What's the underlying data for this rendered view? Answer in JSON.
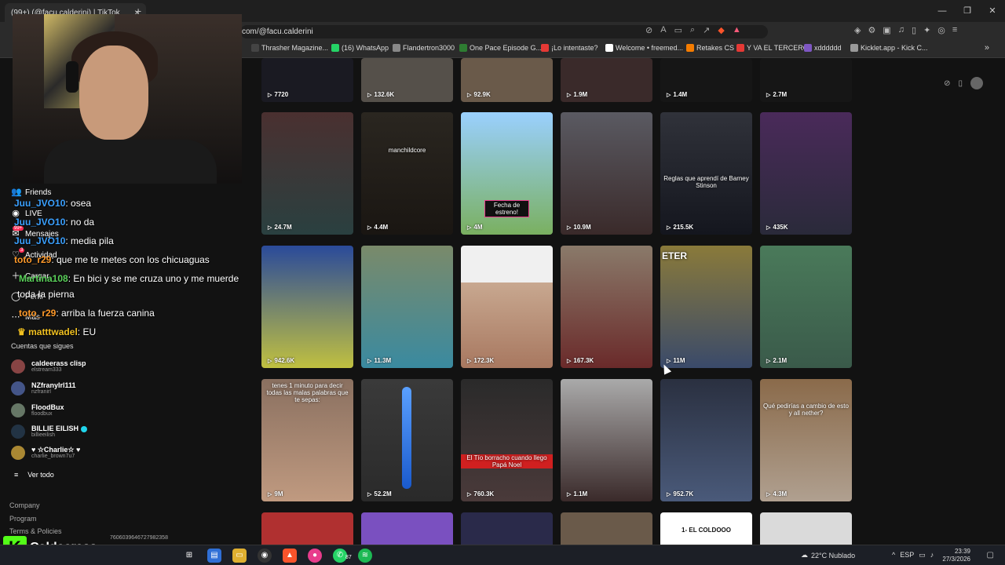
{
  "browser": {
    "tab_title": "(99+) (@facu.calderini) | TikTok",
    "url": "com/@facu.calderini",
    "bookmarks": [
      {
        "label": "Thrasher Magazine...",
        "color": "#444444"
      },
      {
        "label": "(16) WhatsApp",
        "color": "#25d366"
      },
      {
        "label": "Flandertron3000",
        "color": "#888888"
      },
      {
        "label": "One Pace Episode G...",
        "color": "#2e7d32"
      },
      {
        "label": "¡Lo intentaste?",
        "color": "#e53935"
      },
      {
        "label": "Welcome • freemed...",
        "color": "#ffffff"
      },
      {
        "label": "Retakes CS",
        "color": "#f57c00"
      },
      {
        "label": "Y VA EL TERCERO",
        "color": "#e53935"
      },
      {
        "label": "xdddddd",
        "color": "#7e57c2"
      },
      {
        "label": "Kicklet.app - Kick C...",
        "color": "#999999"
      }
    ]
  },
  "sidebar": {
    "nav": [
      {
        "label": "Friends",
        "icon": "friends-icon"
      },
      {
        "label": "LIVE",
        "icon": "live-icon"
      },
      {
        "label": "Mensajes",
        "icon": "messages-icon",
        "badge": "99+"
      },
      {
        "label": "Actividad",
        "icon": "activity-icon",
        "badge": "3"
      },
      {
        "label": "Cargar",
        "icon": "upload-icon"
      },
      {
        "label": "Perfil",
        "icon": "profile-icon"
      },
      {
        "label": "Más",
        "icon": "more-icon"
      }
    ],
    "following_title": "Cuentas que sigues",
    "following": [
      {
        "name": "caldeerass clisp",
        "handle": "elstream333",
        "color": "#884444"
      },
      {
        "name": "NZfranyIrl111",
        "handle": "nzfranirl",
        "color": "#445588"
      },
      {
        "name": "FloodBux",
        "handle": "floodbux",
        "color": "#667766"
      },
      {
        "name": "BILLIE EILISH",
        "handle": "billieeilish",
        "color": "#223344",
        "verified": true
      },
      {
        "name": "♥ ☆Charlie☆ ♥",
        "handle": "charlie_brown7u7",
        "color": "#aa8833"
      }
    ],
    "see_all": "Ver todo",
    "footer": [
      "Company",
      "Program",
      "Terms & Policies"
    ],
    "footer_id": "7606039646727982358"
  },
  "chat": [
    {
      "user": "Juu_JVO10",
      "text": ": osea"
    },
    {
      "user": "Juu_JVO10",
      "text": ": no da"
    },
    {
      "user": "Juu_JVO10",
      "text": ": media pila"
    },
    {
      "user": "toto_r29",
      "text": ": que me te metes con los chicuaguas"
    },
    {
      "user": "Martina108",
      "text": ": En bici y se me cruza uno y me muerde"
    },
    {
      "user": "",
      "text": "toda la pierna"
    },
    {
      "user": "toto_r29",
      "text": ": arriba la fuerza canina"
    },
    {
      "user": "matttwadel",
      "text": ": EU"
    }
  ],
  "stream": {
    "channel": "Caldeerass"
  },
  "videos": {
    "row0": [
      {
        "views": "7720",
        "bg": "#1a1a22"
      },
      {
        "views": "132.6K",
        "bg": "#55504a"
      },
      {
        "views": "92.9K",
        "bg": "#6a5a4a"
      },
      {
        "views": "1.9M",
        "bg": "#3a2a2a"
      },
      {
        "views": "1.4M",
        "bg": "#161616"
      },
      {
        "views": "2.7M",
        "bg": "#161616"
      }
    ],
    "row1": [
      {
        "views": "24.7M",
        "bg": "#3a2a2a",
        "caption": ""
      },
      {
        "views": "4.4M",
        "bg": "#2a2620",
        "caption": "manchildcore"
      },
      {
        "views": "4M",
        "bg": "#7ab060",
        "caption": "Fecha de estreno!"
      },
      {
        "views": "10.9M",
        "bg": "#4a4a52",
        "caption": ""
      },
      {
        "views": "215.5K",
        "bg": "#20222a",
        "caption": "Reglas que aprendí de Barney Stinson"
      },
      {
        "views": "435K",
        "bg": "#3a2a4a",
        "caption": ""
      }
    ],
    "row2": [
      {
        "views": "942.6K",
        "bg": "#2a4a9a",
        "caption": ""
      },
      {
        "views": "11.3M",
        "bg": "#5a7a6a",
        "caption": ""
      },
      {
        "views": "172.3K",
        "bg": "#c8a890",
        "caption": ""
      },
      {
        "views": "167.3K",
        "bg": "#6a5a5a",
        "caption": ""
      },
      {
        "views": "11M",
        "bg": "#6a5a3a",
        "caption": "ETER"
      },
      {
        "views": "2.1M",
        "bg": "#4a7a5a",
        "caption": ""
      }
    ],
    "row3": [
      {
        "views": "9M",
        "bg": "#9a8070",
        "caption": "tenes 1 minuto para decir todas las malas palabras que te sepas:"
      },
      {
        "views": "52.2M",
        "bg": "#3a3a3a",
        "caption": ""
      },
      {
        "views": "760.3K",
        "bg": "#2a2a2a",
        "caption": "El Tío borracho cuando llego Papá Noel"
      },
      {
        "views": "1.1M",
        "bg": "#5a4a4a",
        "caption": ""
      },
      {
        "views": "952.7K",
        "bg": "#2a3040",
        "caption": ""
      },
      {
        "views": "4.3M",
        "bg": "#8a7a6a",
        "caption": "Qué pedirías a cambio de esto y all nether?"
      }
    ],
    "row4": [
      {
        "bg": "#b03030"
      },
      {
        "bg": "#7a50c0"
      },
      {
        "bg": "#2a2a4a"
      },
      {
        "bg": "#6a5a4a"
      },
      {
        "bg": "#ffffff",
        "caption": "1- EL COLDOOO"
      },
      {
        "bg": "#dadada"
      }
    ]
  },
  "taskbar": {
    "weather": "22°C  Nublado",
    "lang": "ESP",
    "time": "23:39",
    "date": "27/3/2026",
    "badge": "87"
  }
}
